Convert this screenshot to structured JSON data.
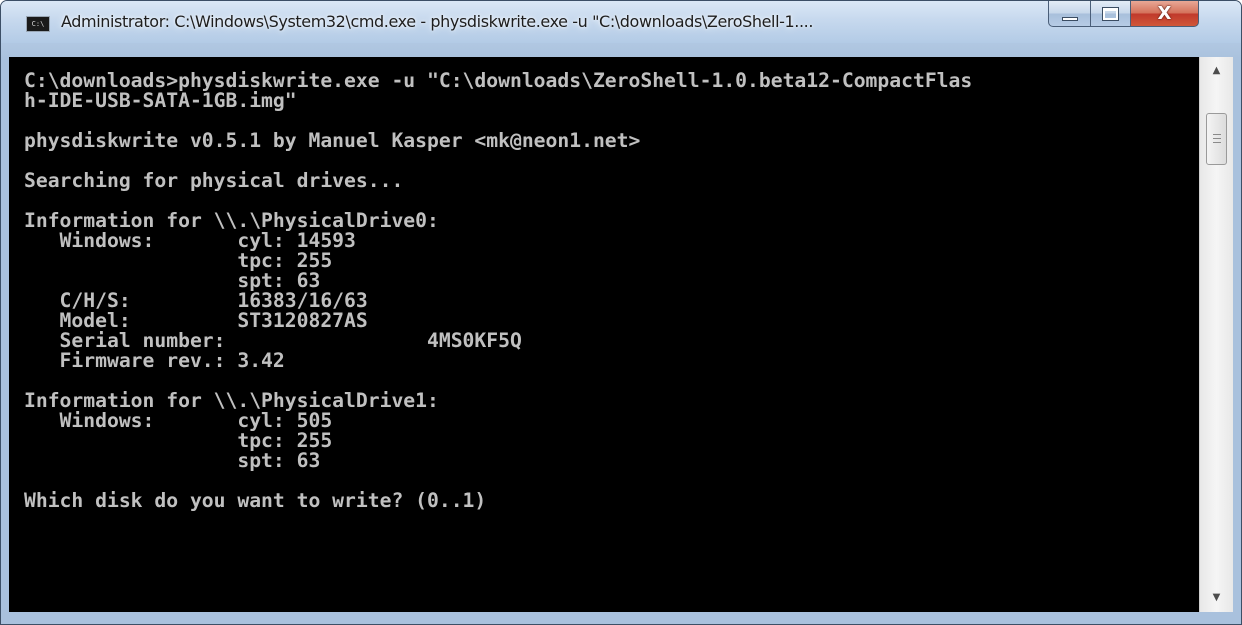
{
  "window": {
    "title": "Administrator: C:\\Windows\\System32\\cmd.exe - physdiskwrite.exe  -u \"C:\\downloads\\ZeroShell-1....",
    "icon": "cmd-icon",
    "icon_label": "C:\\",
    "controls": {
      "minimize": "minimize-icon",
      "maximize": "maximize-icon",
      "close": "close-icon",
      "close_glyph": "X"
    }
  },
  "console": {
    "lines": [
      "C:\\downloads>physdiskwrite.exe -u \"C:\\downloads\\ZeroShell-1.0.beta12-CompactFlas",
      "h-IDE-USB-SATA-1GB.img\"",
      "",
      "physdiskwrite v0.5.1 by Manuel Kasper <mk@neon1.net>",
      "",
      "Searching for physical drives...",
      "",
      "Information for \\\\.\\PhysicalDrive0:",
      "   Windows:       cyl: 14593",
      "                  tpc: 255",
      "                  spt: 63",
      "   C/H/S:         16383/16/63",
      "   Model:         ST3120827AS",
      "   Serial number:                 4MS0KF5Q",
      "   Firmware rev.: 3.42",
      "",
      "Information for \\\\.\\PhysicalDrive1:",
      "   Windows:       cyl: 505",
      "                  tpc: 255",
      "                  spt: 63",
      "",
      "Which disk do you want to write? (0..1)"
    ]
  },
  "colors": {
    "console_bg": "#000000",
    "console_fg": "#c0c0c0",
    "close_button": "#c0392b",
    "titlebar": "#b9d1ea"
  }
}
